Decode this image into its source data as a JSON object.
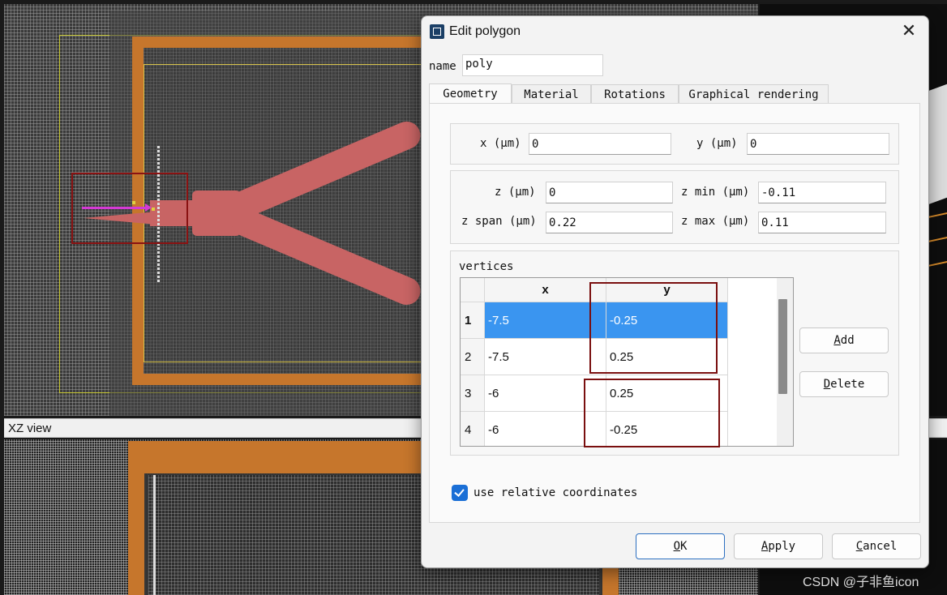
{
  "views": {
    "xz_title": "XZ view"
  },
  "watermark": "CSDN @子非鱼icon",
  "dialog": {
    "title": "Edit polygon",
    "close_glyph": "✕",
    "name_label": "name",
    "name_value": "poly",
    "tabs": [
      {
        "label": "Geometry",
        "active": true
      },
      {
        "label": "Material",
        "active": false
      },
      {
        "label": "Rotations",
        "active": false
      },
      {
        "label": "Graphical rendering",
        "active": false
      }
    ],
    "geometry": {
      "x_label": "x (μm)",
      "x_value": "0",
      "y_label": "y (μm)",
      "y_value": "0",
      "z_label": "z (μm)",
      "z_value": "0",
      "zmin_label": "z min (μm)",
      "zmin_value": "-0.11",
      "zspan_label": "z span (μm)",
      "zspan_value": "0.22",
      "zmax_label": "z max (μm)",
      "zmax_value": "0.11"
    },
    "vertices": {
      "label": "vertices",
      "columns": [
        "x",
        "y"
      ],
      "rows": [
        {
          "index": "1",
          "x": "-7.5",
          "y": "-0.25",
          "selected": true
        },
        {
          "index": "2",
          "x": "-7.5",
          "y": "0.25",
          "selected": false
        },
        {
          "index": "3",
          "x": "-6",
          "y": "0.25",
          "selected": false
        },
        {
          "index": "4",
          "x": "-6",
          "y": "-0.25",
          "selected": false
        }
      ]
    },
    "add_button": {
      "mnemonic": "A",
      "rest": "dd"
    },
    "delete_button": {
      "mnemonic": "D",
      "rest": "elete"
    },
    "relative_coords": {
      "label": "use relative coordinates",
      "checked": true
    },
    "ok_button": {
      "mnemonic": "O",
      "rest": "K"
    },
    "apply_button": {
      "mnemonic": "A",
      "rest": "pply"
    },
    "cancel_button": {
      "mnemonic": "C",
      "rest": "ancel"
    },
    "colors": {
      "selection": "#3a95f0",
      "annotation": "#7a0f0f",
      "checkbox": "#1a6fd6"
    }
  }
}
